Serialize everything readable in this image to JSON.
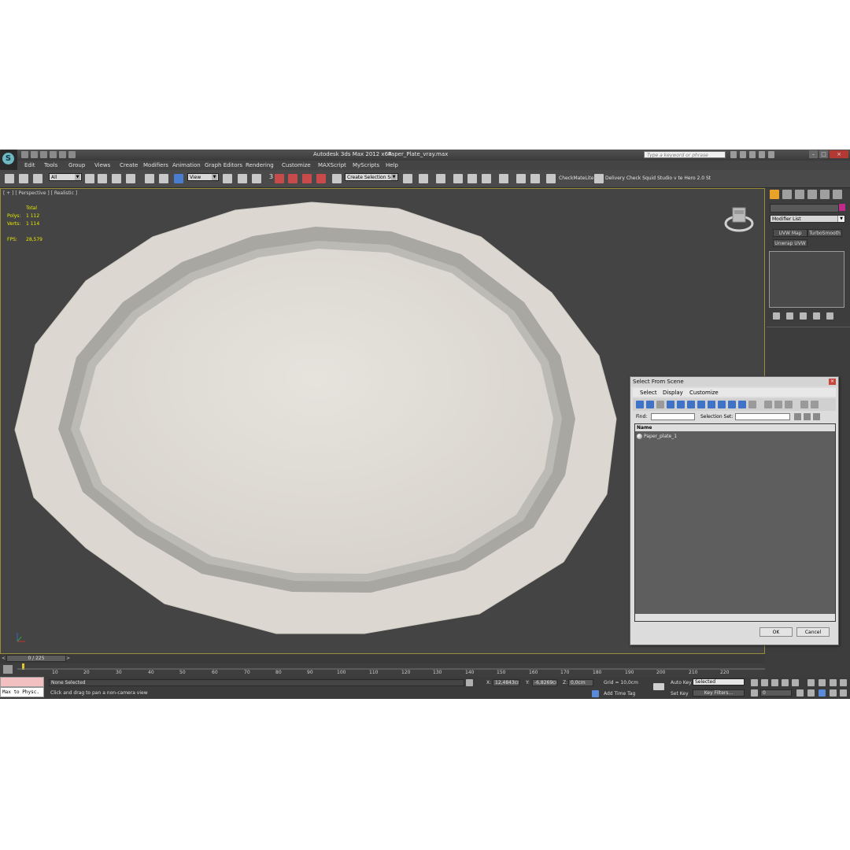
{
  "window": {
    "title": "Autodesk 3ds Max  2012 x64",
    "file": "Paper_Plate_vray.max",
    "search_placeholder": "Type a keyword or phrase"
  },
  "menu": [
    "Edit",
    "Tools",
    "Group",
    "Views",
    "Create",
    "Modifiers",
    "Animation",
    "Graph Editors",
    "Rendering",
    "Customize",
    "MAXScript",
    "MyScripts",
    "Help"
  ],
  "toolbar": {
    "filter": "All",
    "ref_coord": "View",
    "snap_angle": "3",
    "selection_set": "Create Selection Se",
    "checkmate": "CheckMateLite",
    "delivery": "Delivery Check Squid Studio v te Hero 2.0 St"
  },
  "viewport": {
    "label": "[ + ] [ Perspective ] [ Realistic ]",
    "stats": {
      "total_label": "Total",
      "polys_label": "Polys:",
      "polys": "1 112",
      "verts_label": "Verts:",
      "verts": "1 114",
      "fps_label": "FPS:",
      "fps": "28,579"
    }
  },
  "command_panel": {
    "modifier_list": "Modifier List",
    "buttons": [
      "UVW Map",
      "TurboSmooth",
      "Unwrap UVW"
    ]
  },
  "timeline": {
    "slider": "0 / 225",
    "prev": "<",
    "next": ">",
    "ticks": [
      "10",
      "20",
      "30",
      "40",
      "50",
      "60",
      "70",
      "80",
      "90",
      "100",
      "110",
      "120",
      "130",
      "140",
      "150",
      "160",
      "170",
      "180",
      "190",
      "200",
      "210",
      "220"
    ]
  },
  "status": {
    "maxscript": "Max to Physc.",
    "selection": "None Selected",
    "prompt": "Click and drag to pan a non-camera view",
    "x_label": "X:",
    "x": "12,4843cm",
    "y_label": "Y:",
    "y": "-6,8269cm",
    "z_label": "Z:",
    "z": "0,0cm",
    "grid": "Grid = 10,0cm",
    "add_time_tag": "Add Time Tag",
    "auto_key": "Auto Key",
    "selected": "Selected",
    "set_key": "Set Key",
    "key_filters": "Key Filters...",
    "frame": "0"
  },
  "dialog": {
    "title": "Select From Scene",
    "menu": [
      "Select",
      "Display",
      "Customize"
    ],
    "find_label": "Find:",
    "selection_set_label": "Selection Set:",
    "column": "Name",
    "items": [
      "Paper_plate_1"
    ],
    "ok": "OK",
    "cancel": "Cancel"
  },
  "colors": {
    "viewport_bg": "#444444",
    "plate": "#dddad4",
    "stats": "#e8e800",
    "active_border": "#9a8d3a"
  }
}
